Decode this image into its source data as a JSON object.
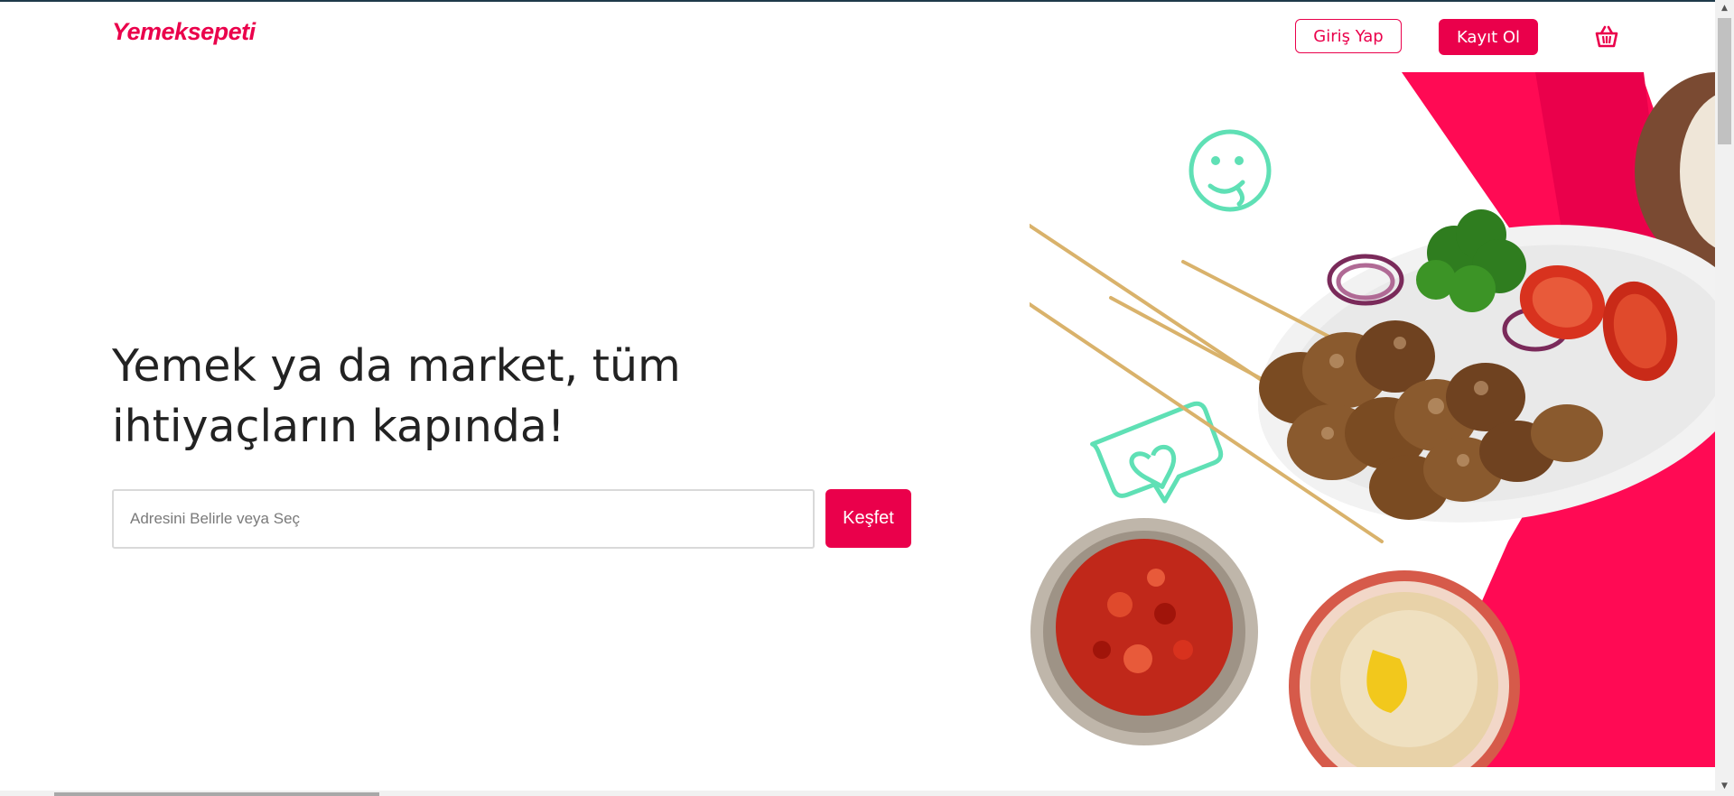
{
  "header": {
    "logo": "Yemeksepeti",
    "login_label": "Giriş Yap",
    "signup_label": "Kayıt Ol",
    "basket_icon": "basket-icon"
  },
  "hero": {
    "title": "Yemek ya da market, tüm ihtiyaçların kapında!",
    "address_placeholder": "Adresini Belirle veya Seç",
    "explore_label": "Keşfet"
  },
  "colors": {
    "brand": "#ea004b",
    "accent_green": "#5fe0b5"
  }
}
